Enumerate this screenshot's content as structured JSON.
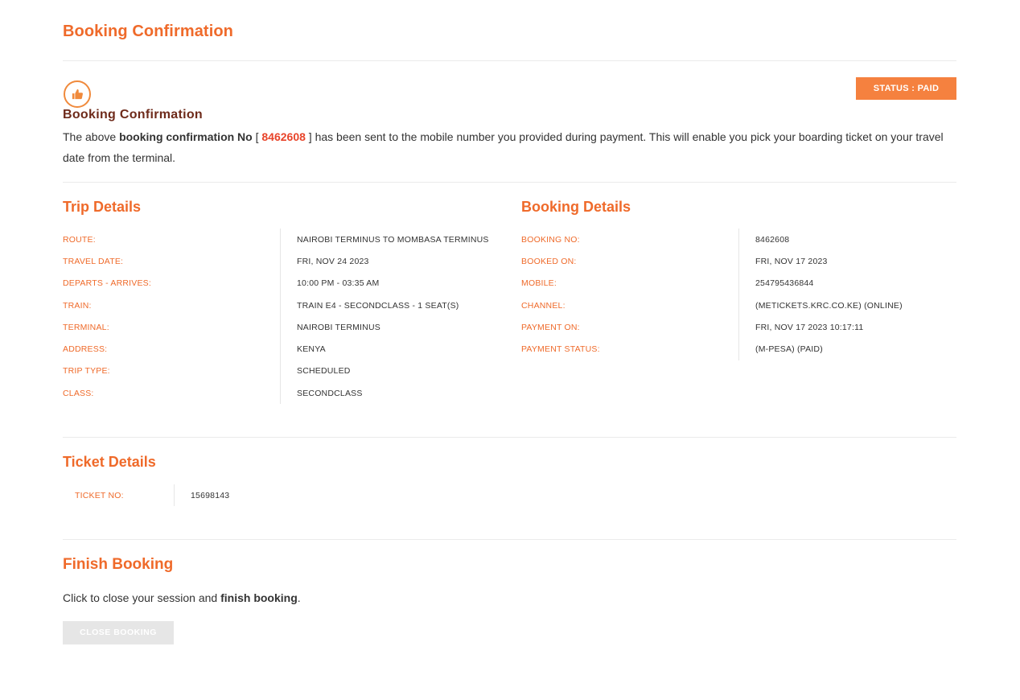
{
  "page": {
    "title": "Booking Confirmation",
    "status": "STATUS : PAID"
  },
  "confirmation": {
    "title": "Booking Confirmation",
    "text_before": "The above ",
    "text_bold": "booking confirmation No",
    "bracket_open": " [ ",
    "number": "8462608",
    "text_after": " ] has been sent to the mobile number you provided during payment. This will enable you pick your boarding ticket on your travel date from the terminal."
  },
  "trip": {
    "title": "Trip Details",
    "rows": [
      {
        "label": "ROUTE:",
        "value": "NAIROBI TERMINUS TO MOMBASA TERMINUS"
      },
      {
        "label": "TRAVEL DATE:",
        "value": "FRI, NOV 24 2023"
      },
      {
        "label": "DEPARTS - ARRIVES:",
        "value": "10:00 PM - 03:35 AM"
      },
      {
        "label": "TRAIN:",
        "value": "TRAIN E4 - SECONDCLASS - 1 SEAT(S)"
      },
      {
        "label": "TERMINAL:",
        "value": "NAIROBI TERMINUS"
      },
      {
        "label": "ADDRESS:",
        "value": "KENYA"
      },
      {
        "label": "TRIP TYPE:",
        "value": "SCHEDULED"
      },
      {
        "label": "CLASS:",
        "value": "SECONDCLASS"
      }
    ]
  },
  "booking": {
    "title": "Booking Details",
    "rows": [
      {
        "label": "BOOKING NO:",
        "value": "8462608"
      },
      {
        "label": "BOOKED ON:",
        "value": "FRI, NOV 17 2023"
      },
      {
        "label": "MOBILE:",
        "value": "254795436844"
      },
      {
        "label": "CHANNEL:",
        "value": "(METICKETS.KRC.CO.KE) (ONLINE)"
      },
      {
        "label": "PAYMENT ON:",
        "value": "FRI, NOV 17 2023 10:17:11"
      },
      {
        "label": "PAYMENT STATUS:",
        "value": "(M-PESA) (PAID)"
      }
    ]
  },
  "ticket": {
    "title": "Ticket Details",
    "label": "TICKET NO:",
    "value": "15698143"
  },
  "finish": {
    "title": "Finish Booking",
    "text_before": "Click to close your session and ",
    "text_bold": "finish booking",
    "text_after": ".",
    "button_label": "CLOSE BOOKING"
  },
  "colors": {
    "accent": "#ef6a2a",
    "badge": "#f5813f",
    "confirmation_number": "#e8442a",
    "button_disabled": "#e6e6e6"
  },
  "icons": {
    "confirmation": "thumbs-up-icon"
  }
}
